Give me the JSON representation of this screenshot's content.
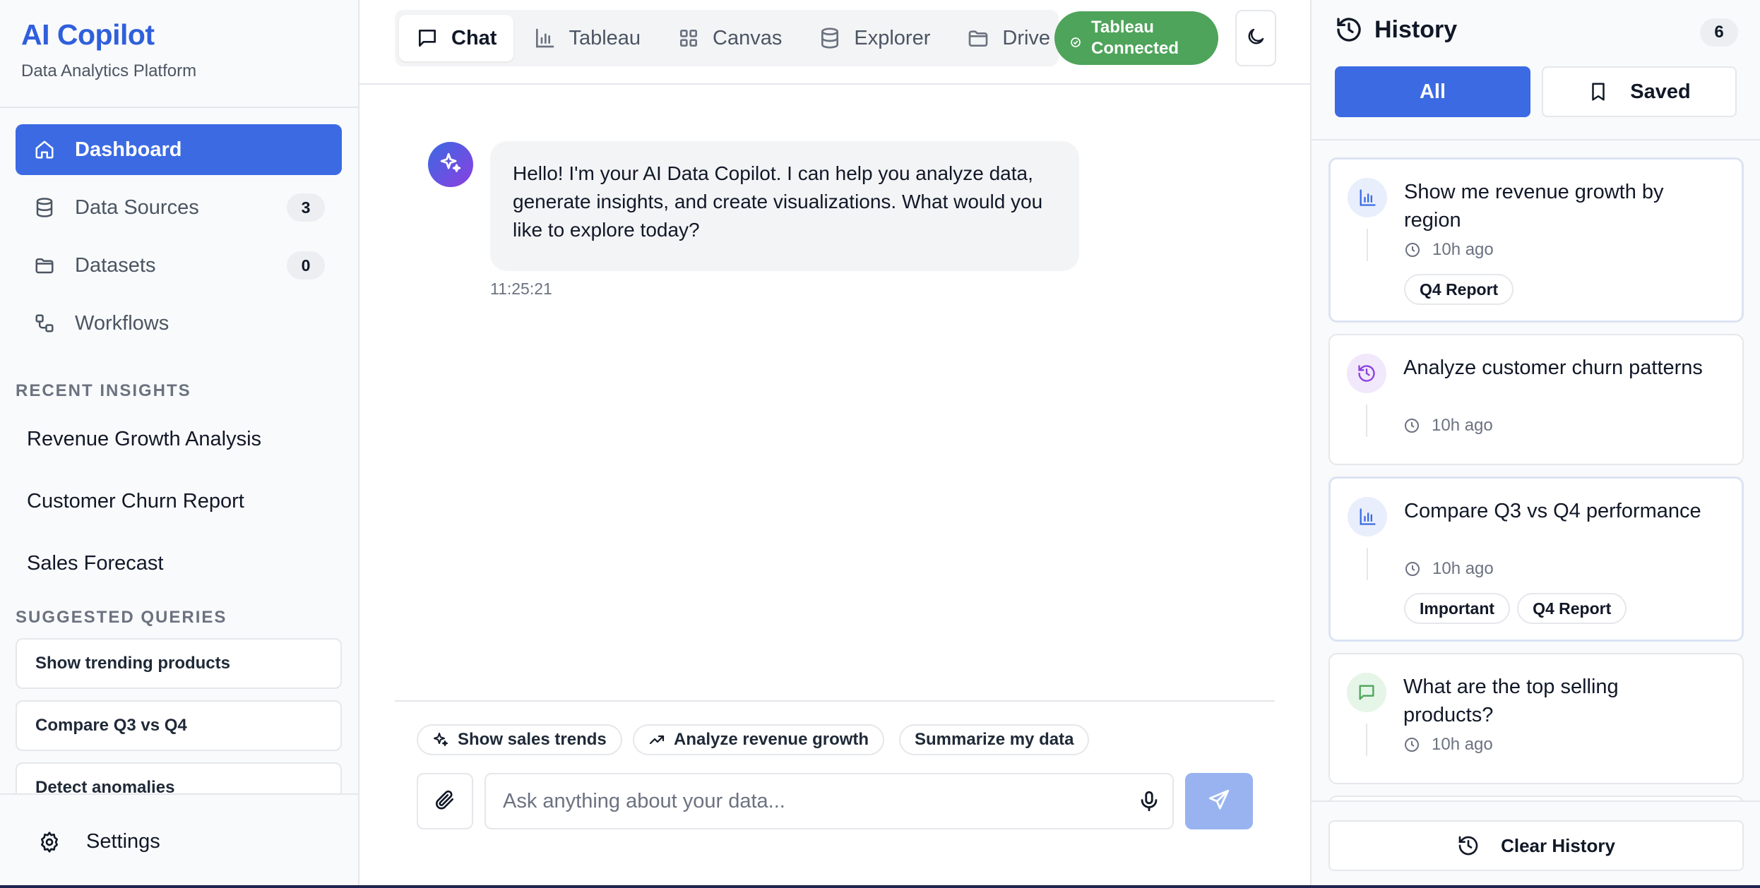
{
  "brand": {
    "title": "AI Copilot",
    "subtitle": "Data Analytics Platform"
  },
  "nav": [
    {
      "label": "Dashboard",
      "icon": "home-icon",
      "active": true
    },
    {
      "label": "Data Sources",
      "icon": "database-icon",
      "badge": "3"
    },
    {
      "label": "Datasets",
      "icon": "folder-icon",
      "badge": "0"
    },
    {
      "label": "Workflows",
      "icon": "workflow-icon"
    }
  ],
  "recent_insights": {
    "title": "RECENT INSIGHTS",
    "items": [
      "Revenue Growth Analysis",
      "Customer Churn Report",
      "Sales Forecast"
    ]
  },
  "suggested_queries": {
    "title": "SUGGESTED QUERIES",
    "items": [
      "Show trending products",
      "Compare Q3 vs Q4",
      "Detect anomalies"
    ]
  },
  "settings_label": "Settings",
  "tabs": [
    {
      "label": "Chat",
      "icon": "message-icon",
      "active": true
    },
    {
      "label": "Tableau",
      "icon": "bar-chart-icon"
    },
    {
      "label": "Canvas",
      "icon": "grid-icon"
    },
    {
      "label": "Explorer",
      "icon": "database-icon"
    },
    {
      "label": "Drive",
      "icon": "folder-icon"
    }
  ],
  "connection": {
    "line1": "Tableau",
    "line2": "Connected",
    "color": "#4ea45a"
  },
  "message": {
    "text": "Hello! I'm your AI Data Copilot. I can help you analyze data, generate insights, and create visualizations. What would you like to explore today?",
    "time": "11:25:21"
  },
  "chips": [
    "Show sales trends",
    "Analyze revenue growth",
    "Summarize my data"
  ],
  "input": {
    "placeholder": "Ask anything about your data..."
  },
  "history": {
    "title": "History",
    "count": "6",
    "filter_all": "All",
    "filter_saved": "Saved",
    "items": [
      {
        "title": "Show me revenue growth by region",
        "time": "10h ago",
        "tags": [
          "Q4 Report"
        ],
        "icon": "bar-chart-icon"
      },
      {
        "title": "Analyze customer churn patterns",
        "time": "10h ago",
        "tags": [],
        "icon": "history-icon"
      },
      {
        "title": "Compare Q3 vs Q4 performance",
        "time": "10h ago",
        "tags": [
          "Important",
          "Q4 Report"
        ],
        "icon": "bar-chart-icon"
      },
      {
        "title": "What are the top selling products?",
        "time": "10h ago",
        "tags": [],
        "icon": "message-icon"
      }
    ],
    "clear_label": "Clear History"
  },
  "colors": {
    "accent": "#3b6ae3",
    "brand": "#2f5fdc",
    "success": "#4ea45a",
    "send_disabled": "#98b3f0"
  }
}
